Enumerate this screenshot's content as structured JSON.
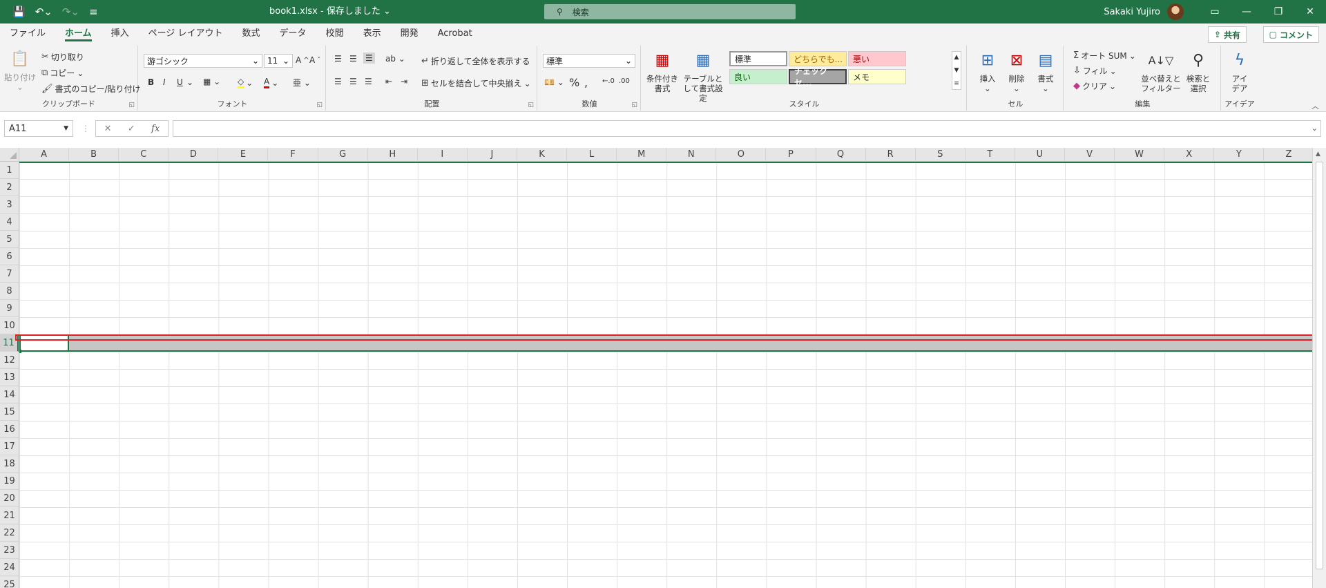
{
  "titlebar": {
    "document_title": "book1.xlsx  -  保存しました",
    "search_label": "検索",
    "user_name": "Sakaki Yujiro"
  },
  "menu": {
    "items": [
      "ファイル",
      "ホーム",
      "挿入",
      "ページ レイアウト",
      "数式",
      "データ",
      "校閲",
      "表示",
      "開発",
      "Acrobat"
    ],
    "active": "ホーム",
    "share_label": "共有",
    "comment_label": "コメント"
  },
  "ribbon": {
    "clipboard": {
      "label": "クリップボード",
      "paste": "貼り付け",
      "cut": "切り取り",
      "copy": "コピー",
      "format_painter": "書式のコピー/貼り付け"
    },
    "font": {
      "label": "フォント",
      "font_name": "游ゴシック",
      "font_size": "11",
      "bold": "B",
      "italic": "I",
      "underline": "U"
    },
    "alignment": {
      "label": "配置",
      "wrap_text": "折り返して全体を表示する",
      "merge_center": "セルを結合して中央揃え"
    },
    "number": {
      "label": "数値",
      "format": "標準"
    },
    "styles": {
      "label": "スタイル",
      "conditional_format": "条件付き書式",
      "format_as_table": "テーブルとして書式設定",
      "cells": [
        {
          "name": "標準",
          "bg": "#ffffff",
          "fg": "#222222"
        },
        {
          "name": "どちらでも...",
          "bg": "#ffeb9c",
          "fg": "#9c6500"
        },
        {
          "name": "悪い",
          "bg": "#ffc7ce",
          "fg": "#9c0006"
        },
        {
          "name": "良い",
          "bg": "#c6efce",
          "fg": "#006100"
        },
        {
          "name": "チェック セ...",
          "bg": "#a5a5a5",
          "fg": "#ffffff"
        },
        {
          "name": "メモ",
          "bg": "#ffffcc",
          "fg": "#222222"
        }
      ]
    },
    "cells": {
      "label": "セル",
      "insert": "挿入",
      "delete": "削除",
      "format": "書式"
    },
    "editing": {
      "label": "編集",
      "autosum": "オート SUM",
      "fill": "フィル",
      "clear": "クリア",
      "sort_filter": "並べ替えと フィルター",
      "find_select": "検索と 選択"
    },
    "ideas": {
      "label": "アイデア",
      "button": "アイ デア"
    }
  },
  "formula_bar": {
    "name_box": "A11",
    "fx": "fx",
    "value": ""
  },
  "sheet": {
    "columns": [
      "A",
      "B",
      "C",
      "D",
      "E",
      "F",
      "G",
      "H",
      "I",
      "J",
      "K",
      "L",
      "M",
      "N",
      "O",
      "P",
      "Q",
      "R",
      "S",
      "T",
      "U",
      "V",
      "W",
      "X",
      "Y",
      "Z"
    ],
    "rows": [
      "1",
      "2",
      "3",
      "4",
      "5",
      "6",
      "7",
      "8",
      "9",
      "10",
      "11",
      "12",
      "13",
      "14",
      "15",
      "16",
      "17",
      "18",
      "19",
      "20",
      "21",
      "22",
      "23",
      "24",
      "25"
    ],
    "selected_row": "11",
    "active_cell": "A11"
  },
  "colors": {
    "accent": "#217346",
    "highlight": "#e02020"
  }
}
